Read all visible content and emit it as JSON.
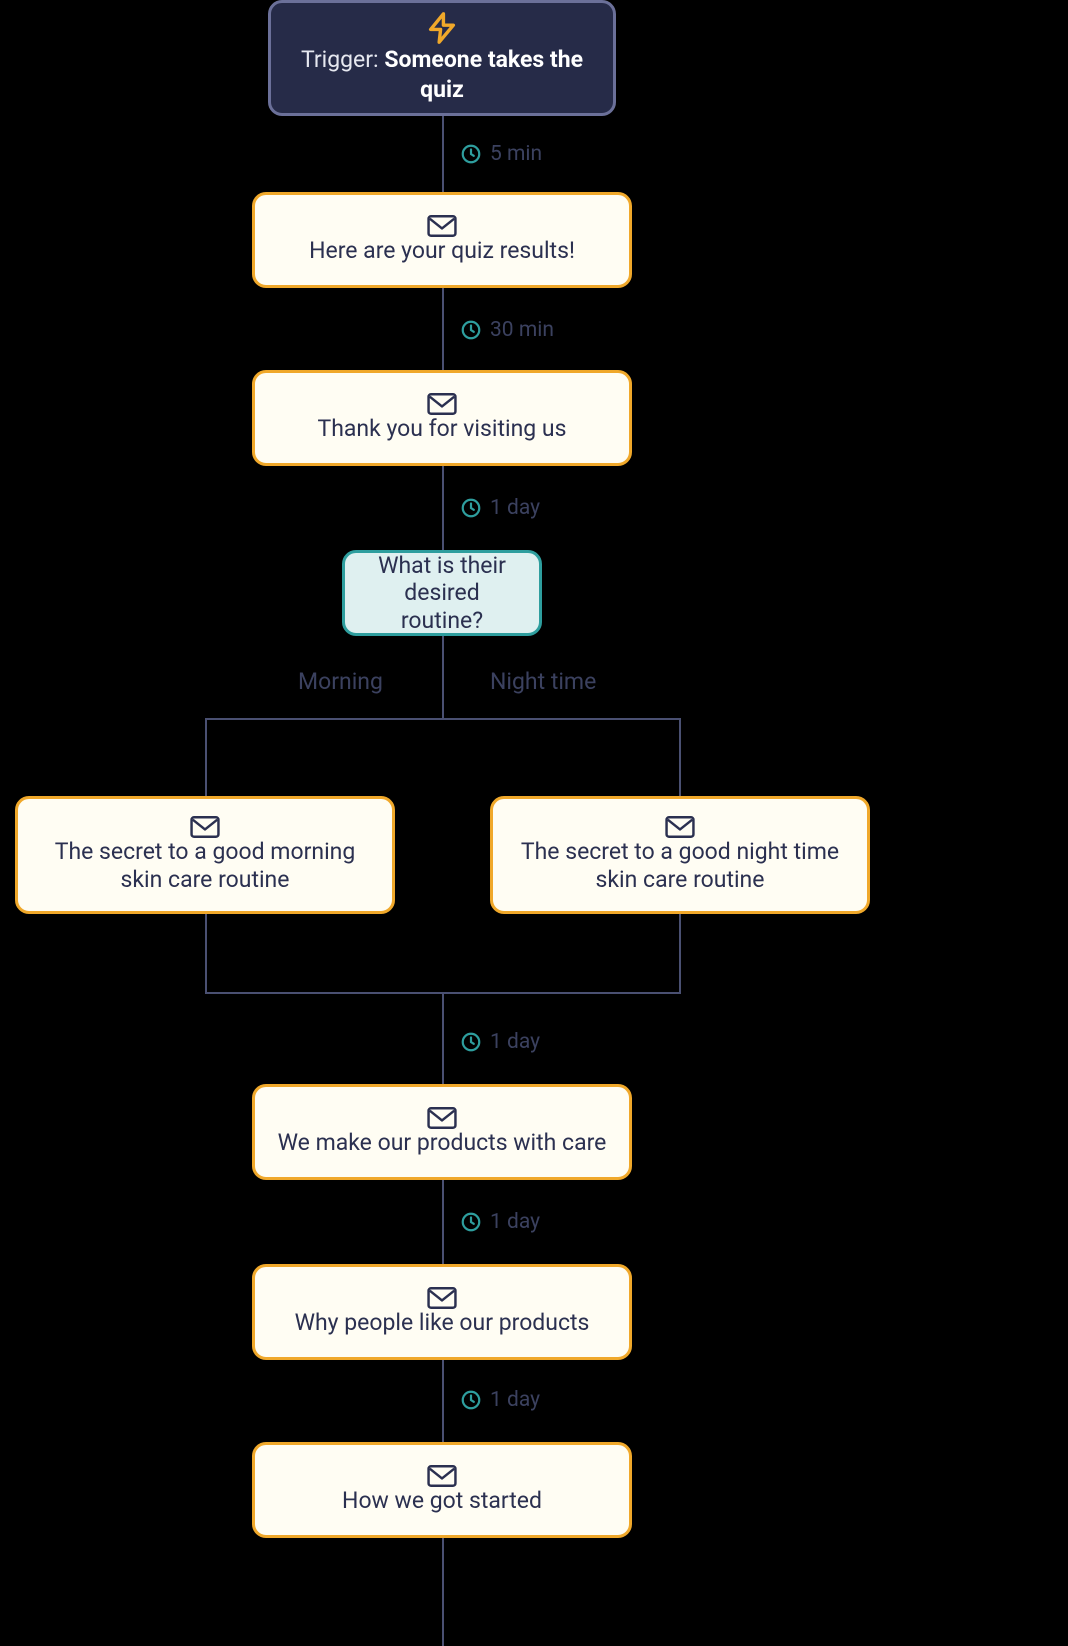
{
  "trigger": {
    "prefix": "Trigger: ",
    "label": "Someone takes the quiz"
  },
  "delays": {
    "d1": "5 min",
    "d2": "30 min",
    "d3": "1 day",
    "d4": "1 day",
    "d5": "1 day",
    "d6": "1 day"
  },
  "emails": {
    "e1": "Here are your quiz results!",
    "e2": "Thank you for visiting us",
    "eMorning": "The secret to a good morning skin care routine",
    "eNight": "The secret to a good night time skin care routine",
    "e5": "We make our products with care",
    "e6": "Why people like our products",
    "e7": "How we got started"
  },
  "decision": {
    "label": "What is their desired routine?"
  },
  "branches": {
    "left": "Morning",
    "right": "Night time"
  }
}
